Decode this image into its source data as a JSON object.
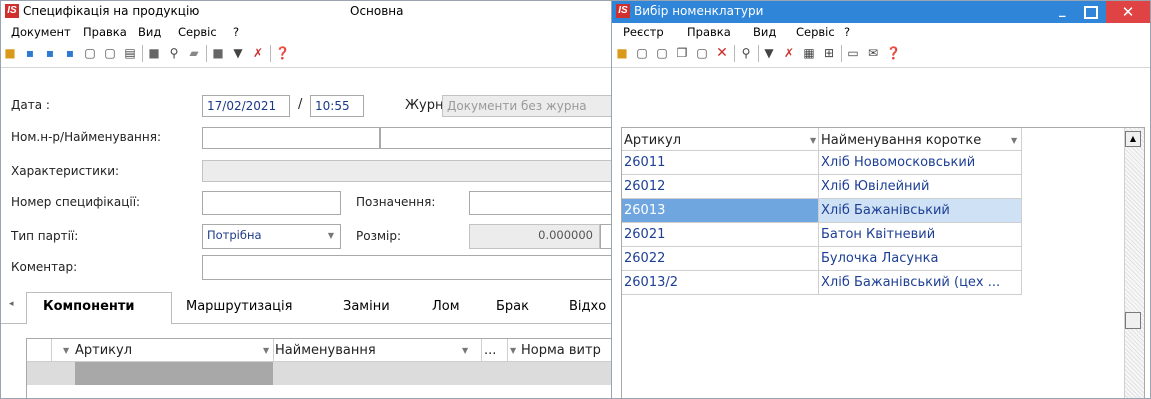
{
  "left_window": {
    "title": "Специфікація на продукцію",
    "title_mode": "Основна",
    "menu": [
      "Документ",
      "Правка",
      "Вид",
      "Сервіс",
      "?"
    ],
    "form": {
      "date_label": "Дата :",
      "date_value": "17/02/2021",
      "date_sep": "/",
      "time_value": "10:55",
      "journal_label": "Журнал",
      "journal_value": "Документи без журна",
      "item_label": "Ном.н-р/Найменування:",
      "item_code": "",
      "item_name": "",
      "characteristics_label": "Характеристики:",
      "characteristics_value": "",
      "spec_number_label": "Номер специфікації:",
      "spec_number_value": "",
      "designation_label": "Позначення:",
      "designation_value": "",
      "batch_type_label": "Тип партії:",
      "batch_type_value": "Потрібна",
      "size_label": "Розмір:",
      "size_value": "0.000000",
      "comment_label": "Коментар:",
      "comment_value": ""
    },
    "tabs": [
      "Компоненти",
      "Маршрутизація",
      "Заміни",
      "Лом",
      "Брак",
      "Відхо"
    ],
    "active_tab": "Компоненти",
    "columns": {
      "article": "Артикул",
      "name": "Найменування",
      "dots": "...",
      "norm": "Норма витр"
    }
  },
  "right_window": {
    "title": "Вибір номенклатури",
    "menu": [
      "Реєстр",
      "Правка",
      "Вид",
      "Сервіс",
      "?"
    ],
    "columns": {
      "article": "Артикул",
      "short_name": "Найменування коротке"
    },
    "rows": [
      {
        "article": "26011",
        "name": "Хліб Новомосковський",
        "selected": false
      },
      {
        "article": "26012",
        "name": "Хліб Ювілейний",
        "selected": false
      },
      {
        "article": "26013",
        "name": "Хліб Бажанівський",
        "selected": true
      },
      {
        "article": "26021",
        "name": "Батон Квітневий",
        "selected": false
      },
      {
        "article": "26022",
        "name": "Булочка Ласунка",
        "selected": false
      },
      {
        "article": "26013/2",
        "name": "Хліб Бажанівський (цех ...",
        "selected": false
      }
    ]
  },
  "colors": {
    "title_active": "#2f85d8",
    "close_button": "#e04343",
    "selection": "#cfe2f5",
    "app_icon": "#d0302d"
  }
}
